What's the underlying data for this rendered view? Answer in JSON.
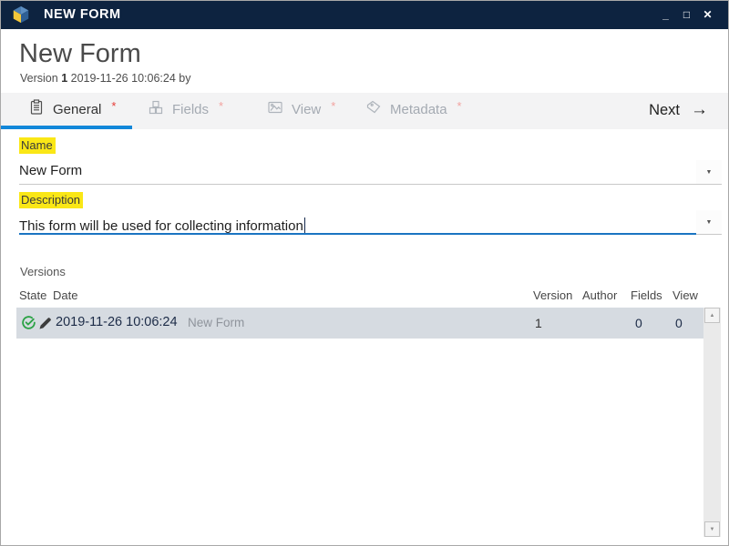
{
  "window": {
    "title": "NEW FORM",
    "controls": {
      "minimize": "_",
      "maximize": "□",
      "close": "✕"
    }
  },
  "header": {
    "title": "New Form",
    "version_label": "Version",
    "version_number": "1",
    "version_datetime": "2019-11-26 10:06:24",
    "version_suffix": "by"
  },
  "tabs": {
    "items": [
      {
        "label": "General",
        "icon": "clipboard-icon",
        "required": "*",
        "active": true
      },
      {
        "label": "Fields",
        "icon": "cubes-icon",
        "required": "*",
        "active": false
      },
      {
        "label": "View",
        "icon": "image-icon",
        "required": "*",
        "active": false
      },
      {
        "label": "Metadata",
        "icon": "tag-icon",
        "required": "*",
        "active": false
      }
    ],
    "next_label": "Next",
    "next_arrow": "→"
  },
  "form": {
    "name": {
      "label": "Name",
      "value": "New Form"
    },
    "description": {
      "label": "Description",
      "value": "This form will be used for collecting information"
    },
    "dropdown_glyph": "▼"
  },
  "versions": {
    "section_label": "Versions",
    "columns": [
      "State",
      "Date",
      "Version",
      "Author",
      "Fields",
      "View"
    ],
    "rows": [
      {
        "state_icons": [
          "check-circle-icon",
          "pencil-icon"
        ],
        "date": "2019-11-26 10:06:24",
        "name": "New Form",
        "version": "1",
        "author": "",
        "fields": "0",
        "view": "0"
      }
    ]
  },
  "scrollbar": {
    "up": "▲",
    "down": "▼"
  },
  "colors": {
    "titlebar": "#0d2340",
    "accent_blue": "#1287d9",
    "focus_blue": "#1b74c2",
    "highlight_yellow": "#fae716",
    "row_bg": "#d6dbe1",
    "state_green": "#2ba245",
    "required_red": "#e63b36",
    "required_pink": "#f2a29f"
  }
}
